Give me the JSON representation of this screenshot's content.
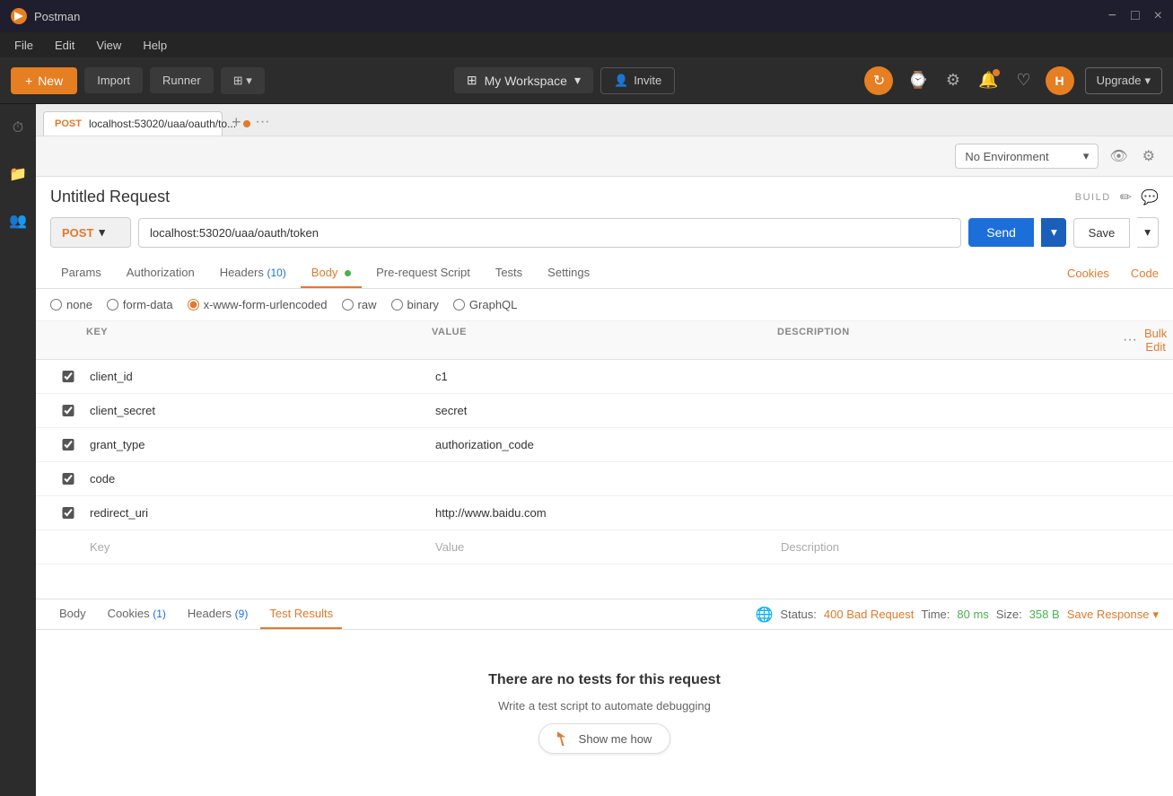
{
  "app": {
    "title": "Postman",
    "icon": "P"
  },
  "title_bar": {
    "minimize": "−",
    "maximize": "□",
    "close": "×"
  },
  "menu": {
    "items": [
      "File",
      "Edit",
      "View",
      "Help"
    ]
  },
  "toolbar": {
    "new_label": "New",
    "import_label": "Import",
    "runner_label": "Runner",
    "workspace_label": "My Workspace",
    "invite_label": "Invite",
    "upgrade_label": "Upgrade",
    "avatar_initials": "H"
  },
  "tabs": {
    "active_tab_method": "POST",
    "active_tab_url": "localhost:53020/uaa/oauth/to...",
    "add_tab": "+",
    "more": "···"
  },
  "env": {
    "selected": "No Environment"
  },
  "request": {
    "title": "Untitled Request",
    "build_label": "BUILD",
    "method": "POST",
    "url": "localhost:53020/uaa/oauth/token",
    "send_label": "Send",
    "save_label": "Save"
  },
  "req_tabs": {
    "params": "Params",
    "authorization": "Authorization",
    "headers": "Headers",
    "headers_count": "(10)",
    "body": "Body",
    "pre_request": "Pre-request Script",
    "tests": "Tests",
    "settings": "Settings",
    "cookies": "Cookies",
    "code": "Code"
  },
  "body_types": {
    "none": "none",
    "form_data": "form-data",
    "url_encoded": "x-www-form-urlencoded",
    "raw": "raw",
    "binary": "binary",
    "graphql": "GraphQL"
  },
  "kv_table": {
    "col_key": "KEY",
    "col_value": "VALUE",
    "col_description": "DESCRIPTION",
    "bulk_edit": "Bulk Edit",
    "rows": [
      {
        "key": "client_id",
        "value": "c1",
        "description": "",
        "checked": true
      },
      {
        "key": "client_secret",
        "value": "secret",
        "description": "",
        "checked": true
      },
      {
        "key": "grant_type",
        "value": "authorization_code",
        "description": "",
        "checked": true
      },
      {
        "key": "code",
        "value": "",
        "description": "",
        "checked": true
      },
      {
        "key": "redirect_uri",
        "value": "http://www.baidu.com",
        "description": "",
        "checked": true
      }
    ],
    "empty_key": "Key",
    "empty_value": "Value",
    "empty_description": "Description"
  },
  "response": {
    "body_tab": "Body",
    "cookies_tab": "Cookies",
    "cookies_count": "(1)",
    "headers_tab": "Headers",
    "headers_count": "(9)",
    "test_results_tab": "Test Results",
    "status_label": "Status:",
    "status_value": "400 Bad Request",
    "time_label": "Time:",
    "time_value": "80 ms",
    "size_label": "Size:",
    "size_value": "358 B",
    "save_response": "Save Response"
  },
  "empty_state": {
    "title": "There are no tests for this request",
    "subtitle": "Write a test script to automate debugging",
    "show_how": "Show me how"
  }
}
